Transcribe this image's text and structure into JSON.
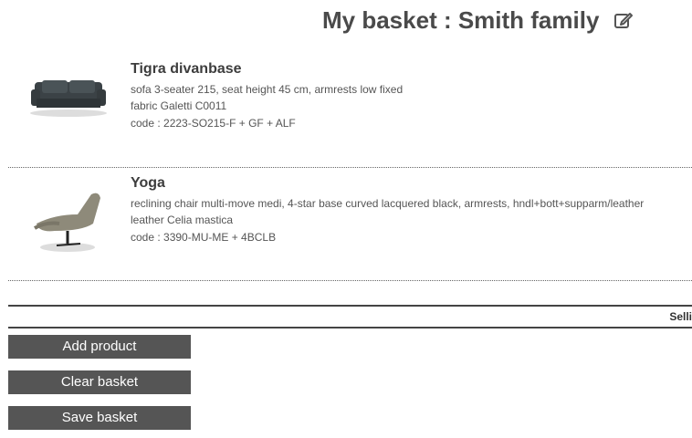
{
  "header": {
    "title": "My basket : Smith family",
    "edit_icon": "edit-icon"
  },
  "items": [
    {
      "name": "Tigra divanbase",
      "description": "sofa 3-seater 215, seat height 45 cm, armrests low fixed",
      "fabric": "fabric Galetti C0011",
      "code": "code : 2223-SO215-F + GF + ALF"
    },
    {
      "name": "Yoga",
      "description": "reclining chair multi-move medi, 4-star base curved lacquered black, armrests, hndl+bott+supparm/leather",
      "fabric": "leather Celia mastica",
      "code": "code : 3390-MU-ME + 4BCLB"
    }
  ],
  "totals": {
    "label": "Selli"
  },
  "actions": {
    "add_product": "Add product",
    "clear_basket": "Clear basket",
    "save_basket": "Save basket"
  },
  "colors": {
    "button_bg": "#555555",
    "text": "#4a4a4a"
  }
}
